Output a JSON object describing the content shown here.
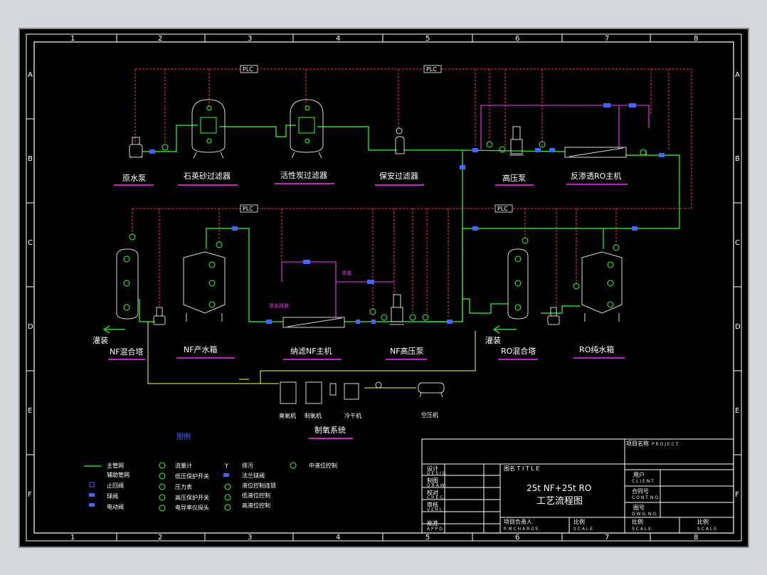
{
  "grid": {
    "columns": [
      "1",
      "2",
      "3",
      "4",
      "5",
      "6",
      "7",
      "8"
    ],
    "rows": [
      "A",
      "B",
      "C",
      "D",
      "E",
      "F"
    ]
  },
  "plc": [
    "PLC",
    "PLC",
    "PLC",
    "PLC"
  ],
  "equipment": {
    "raw_pump": "原水泵",
    "quartz_filter": "石英砂过滤器",
    "carbon_filter": "活性炭过滤器",
    "security_filter": "保安过滤器",
    "hp_pump": "高压泵",
    "ro_main": "反渗透RO主机",
    "nf_mix_tower": "NF混合塔",
    "nf_tank": "NF产水箱",
    "nf_main": "纳滤NF主机",
    "nf_hp_pump": "NF高压泵",
    "ro_mix_tower": "RO混合塔",
    "ro_tank": "RO纯水箱",
    "fill_left": "灌装",
    "fill_right": "灌装",
    "ozone_gen": "臭氧机",
    "oxygen_gen": "制氧机",
    "dryer": "冷干机",
    "compressor": "空压机",
    "oxygen_system": "制氧系统",
    "concentrate": "浓水排放",
    "waste": "浓液"
  },
  "legend": {
    "title": "图例",
    "col1": [
      "主管网",
      "辅助管网",
      "止回阀",
      "球阀",
      "电动阀"
    ],
    "col2": [
      "流量计",
      "低压保护开关",
      "压力表",
      "高压保护开关",
      "电导率仪探头"
    ],
    "col3": [
      "排污",
      "法兰球阀",
      "液位控制连锁",
      "低液位控制",
      "高液位控制"
    ],
    "col4": [
      "中液位控制"
    ]
  },
  "title_block": {
    "project_label": "项目名称",
    "project_en": "P R O J E C T.",
    "design": "设计",
    "design_en": "D E S I G.",
    "draw": "制图",
    "draw_en": "D R A W.",
    "check": "校对",
    "check_en": "C H E C.",
    "verify": "审核",
    "verify_en": "V E R I.",
    "approve": "批准",
    "approve_en": "A P P D.",
    "title_label": "图名  T I T L E",
    "drawing_title_1": "25t NF+25t RO",
    "drawing_title_2": "工艺流程图",
    "user": "用户",
    "user_en": "C L I E N T.",
    "contract": "合同号",
    "contract_en": "C O N T. N O.",
    "drawing_no": "图号",
    "drawing_no_en": "D W G. N O.",
    "pm": "项目负责人",
    "pm_en": "P. M C H A R G E.",
    "scale1": "比例",
    "scale1_en": "S C A L E.",
    "scale2": "比例",
    "scale2_en": "S C A L E.",
    "scale3": "比例",
    "scale3_en": "S C A L E."
  },
  "colors": {
    "background": "#000000",
    "main_pipe": "#33ff33",
    "aux_pipe": "#ff33ff",
    "control_line": "#ff3333",
    "air_line": "#ffff66",
    "valve": "#4466ff",
    "equipment": "#d8d8d8"
  }
}
